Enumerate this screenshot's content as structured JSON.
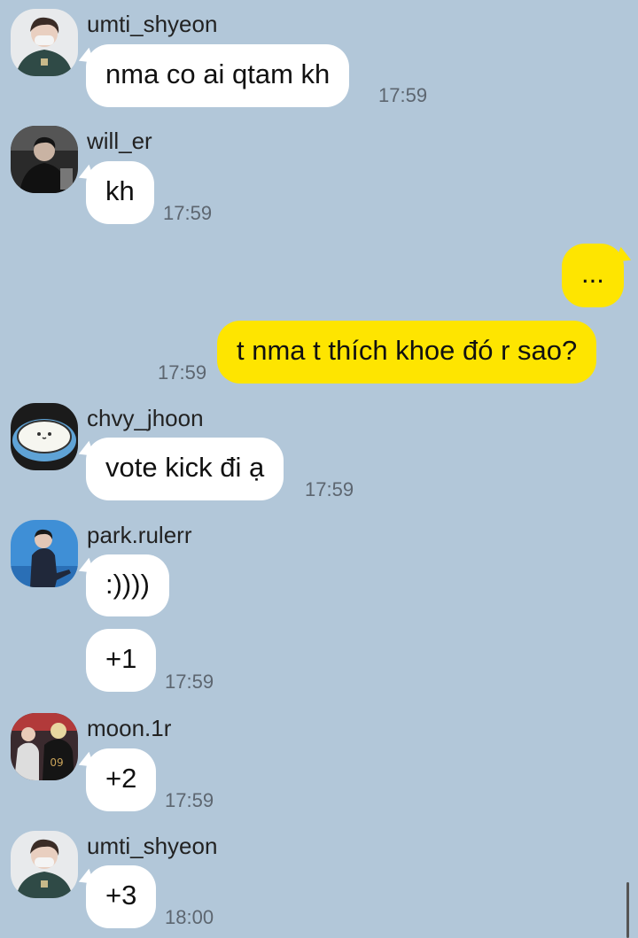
{
  "messages": [
    {
      "sender": "umti_shyeon",
      "avatar": "avatar-umti-shyeon",
      "text": "nma co ai qtam kh",
      "time": "17:59"
    },
    {
      "sender": "will_er",
      "avatar": "avatar-will-er",
      "text": "kh",
      "time": "17:59"
    },
    {
      "sender": "me",
      "text": "...",
      "time": ""
    },
    {
      "sender": "me",
      "text": "t nma t thích khoe đó r sao?",
      "time": "17:59"
    },
    {
      "sender": "chvy_jhoon",
      "avatar": "avatar-chvy-jhoon",
      "text": "vote kick đi ạ",
      "time": "17:59"
    },
    {
      "sender": "park.rulerr",
      "avatar": "avatar-park-rulerr",
      "text": ":))))",
      "time": ""
    },
    {
      "sender": "park.rulerr",
      "text": "+1",
      "time": "17:59"
    },
    {
      "sender": "moon.1r",
      "avatar": "avatar-moon-1r",
      "text": "+2",
      "time": "17:59"
    },
    {
      "sender": "umti_shyeon",
      "avatar": "avatar-umti-shyeon",
      "text": "+3",
      "time": "18:00"
    }
  ],
  "colors": {
    "background": "#b2c7d9",
    "incoming_bubble": "#ffffff",
    "outgoing_bubble": "#fee500",
    "timestamp": "#5d6670"
  }
}
